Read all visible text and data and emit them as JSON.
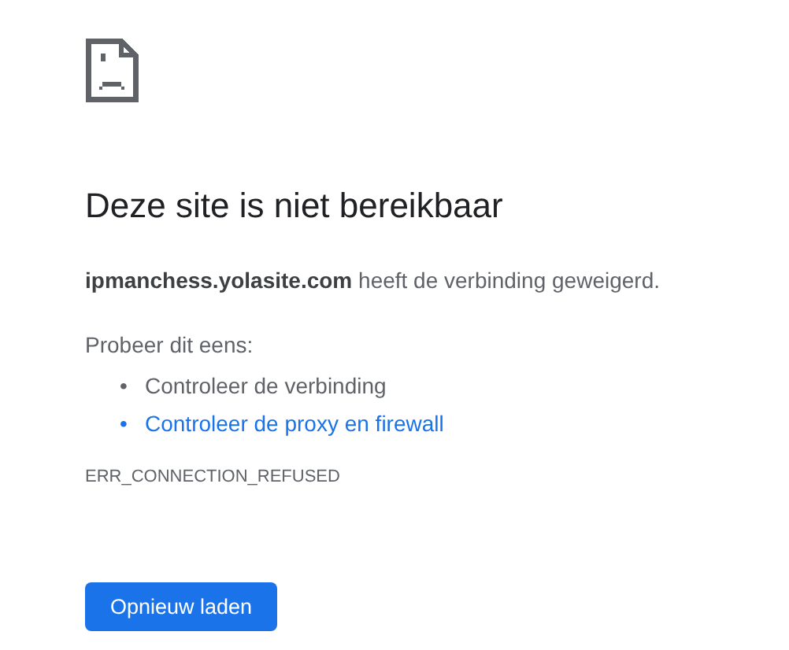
{
  "heading": "Deze site is niet bereikbaar",
  "description": "**ipmanchess.yolasite.com** heeft de verbinding geweigerd.",
  "suggestions": {
    "intro": "Probeer dit eens:",
    "items": [
      {
        "kind": "text",
        "bullet": "•",
        "label": "Controleer de verbinding"
      },
      {
        "kind": "link",
        "bullet": "•",
        "label": "Controleer de proxy en firewall"
      }
    ]
  },
  "error_code": "ERR_CONNECTION_REFUSED",
  "reload_button": "Opnieuw laden"
}
